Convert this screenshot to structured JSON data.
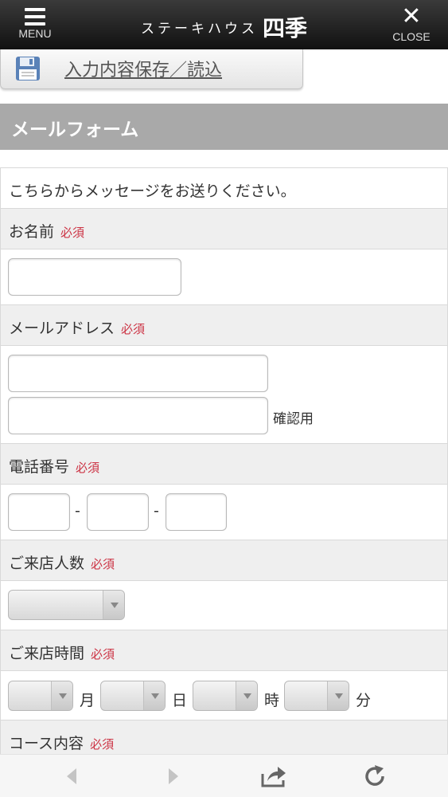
{
  "header": {
    "menu_label": "MENU",
    "close_label": "CLOSE",
    "brand_kana": "ステーキハウス",
    "brand_kanji": "四季"
  },
  "save": {
    "label": "入力内容保存／読込"
  },
  "section": {
    "title": "メールフォーム"
  },
  "form": {
    "intro": "こちらからメッセージをお送りください。",
    "required_label": "必須",
    "fields": {
      "name": {
        "label": "お名前"
      },
      "email": {
        "label": "メールアドレス",
        "confirm_label": "確認用"
      },
      "phone": {
        "label": "電話番号",
        "separator": "-"
      },
      "guests": {
        "label": "ご来店人数"
      },
      "visit_time": {
        "label": "ご来店時間",
        "units": [
          "月",
          "日",
          "時",
          "分"
        ]
      },
      "course": {
        "label": "コース内容"
      }
    }
  },
  "toolbar": {
    "icons": [
      "back-icon",
      "forward-icon",
      "share-icon",
      "reload-icon"
    ]
  },
  "colors": {
    "header_bg": "#1a1a1a",
    "section_bar": "#a9a9a9",
    "required": "#cc3344",
    "label_row_bg": "#efefef"
  }
}
